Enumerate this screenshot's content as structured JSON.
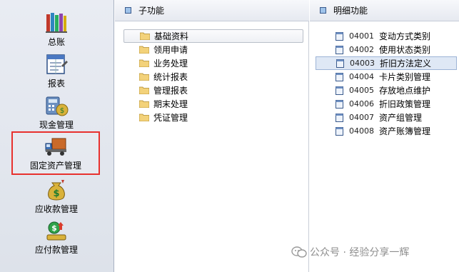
{
  "left_nav": {
    "items": [
      {
        "label": "总账",
        "icon": "ledger-books-icon"
      },
      {
        "label": "报表",
        "icon": "report-form-icon"
      },
      {
        "label": "现金管理",
        "icon": "cash-calculator-icon"
      },
      {
        "label": "固定资产管理",
        "icon": "fixed-asset-truck-icon",
        "selected": true
      },
      {
        "label": "应收款管理",
        "icon": "money-bag-receivable-icon"
      },
      {
        "label": "应付款管理",
        "icon": "money-payable-icon"
      }
    ]
  },
  "sub_function": {
    "header": "子功能",
    "folders": [
      {
        "label": "基础资料",
        "selected": true
      },
      {
        "label": "领用申请"
      },
      {
        "label": "业务处理"
      },
      {
        "label": "统计报表"
      },
      {
        "label": "管理报表"
      },
      {
        "label": "期末处理"
      },
      {
        "label": "凭证管理"
      }
    ]
  },
  "detail_function": {
    "header": "明细功能",
    "items": [
      {
        "code": "04001",
        "name": "变动方式类别"
      },
      {
        "code": "04002",
        "name": "使用状态类别"
      },
      {
        "code": "04003",
        "name": "折旧方法定义",
        "selected": true
      },
      {
        "code": "04004",
        "name": "卡片类别管理"
      },
      {
        "code": "04005",
        "name": "存放地点维护"
      },
      {
        "code": "04006",
        "name": "折旧政策管理"
      },
      {
        "code": "04007",
        "name": "资产组管理"
      },
      {
        "code": "04008",
        "name": "资产账簿管理"
      }
    ]
  },
  "watermark": {
    "text": "公众号 · 经验分享一辉"
  }
}
